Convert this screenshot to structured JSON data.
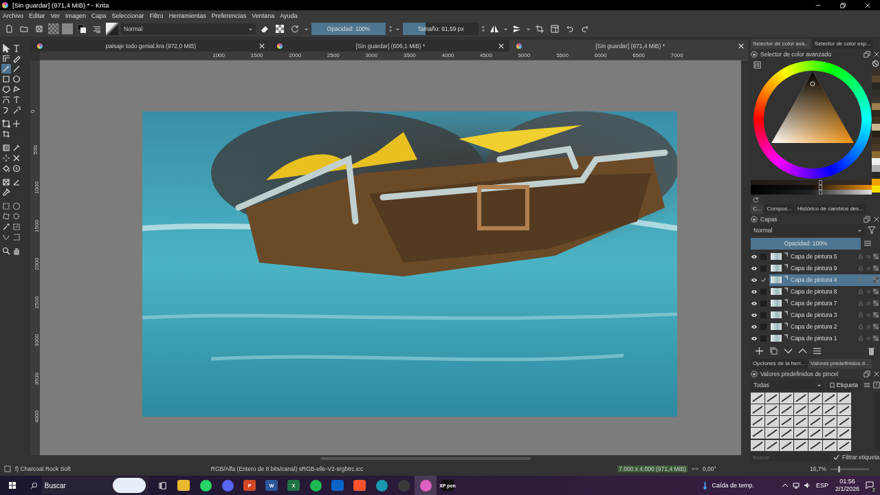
{
  "window": {
    "title": "[Sin guardar]  (971,4 MiB) * - Krita"
  },
  "menu": [
    "Archivo",
    "Editar",
    "Ver",
    "Imagen",
    "Capa",
    "Seleccionar",
    "Filtro",
    "Herramientas",
    "Preferencias",
    "Ventana",
    "Ayuda"
  ],
  "toolbar": {
    "blend_mode": "Normal",
    "opacity": {
      "label": "Opacidad: 100%",
      "level": 1
    },
    "size": {
      "label": "Tamaño: 61,59 px",
      "level": 0.3
    }
  },
  "tool_groups": [
    [
      {
        "selected": false
      },
      {
        "selected": false
      },
      {
        "selected": false
      },
      {
        "selected": false
      },
      {
        "selected": true
      },
      {
        "selected": false
      },
      {
        "selected": false
      },
      {
        "selected": false
      },
      {
        "selected": false
      },
      {
        "selected": false
      },
      {
        "selected": false
      },
      {
        "selected": false
      },
      {
        "selected": false
      },
      {
        "selected": false
      }
    ],
    [
      {
        "selected": false
      },
      {
        "selected": false
      },
      {
        "selected": false
      }
    ],
    [
      {
        "selected": false
      },
      {
        "selected": false
      },
      {
        "selected": false
      },
      {
        "selected": false
      },
      {
        "selected": false
      },
      {
        "selected": false
      }
    ],
    [
      {
        "selected": false
      },
      {
        "selected": false
      },
      {
        "selected": false
      }
    ],
    [
      {
        "selected": false
      },
      {
        "selected": false
      },
      {
        "selected": false
      },
      {
        "selected": false
      },
      {
        "selected": false
      },
      {
        "selected": false
      },
      {
        "selected": false
      },
      {
        "selected": false
      }
    ],
    [
      {
        "selected": false
      },
      {
        "selected": false
      }
    ]
  ],
  "documents": [
    {
      "title": "paisaje todo genial.kra (972,0 MiB)",
      "selected": false
    },
    {
      "title": "[Sin guardar]  (606,1 MiB) *",
      "selected": false
    },
    {
      "title": "[Sin guardar]  (971,4 MiB) *",
      "selected": true
    }
  ],
  "rulers": {
    "horizontal": [
      "1000",
      "1500",
      "2000",
      "2500",
      "3000",
      "3500",
      "4000",
      "4500",
      "5000",
      "5500",
      "6000",
      "6500",
      "7000"
    ],
    "vertical": [
      "0",
      "500",
      "1000",
      "1500",
      "2000",
      "2500",
      "3000",
      "3500",
      "4000"
    ]
  },
  "color_dock": {
    "tabs": [
      {
        "label": "Selector de color ava...",
        "selected": true
      },
      {
        "label": "Selector de color esp...",
        "selected": false
      }
    ],
    "title": "Selector de color avanzado",
    "sliders": [
      {
        "level": 0.56
      },
      {
        "level": 0.56
      },
      {
        "level": 0.56
      }
    ],
    "swatches": [
      {
        "color": "#3a3228"
      },
      {
        "color": "#5a4530"
      },
      {
        "color": "#2a2620"
      },
      {
        "color": "#302c26"
      },
      {
        "color": "#3c3630"
      },
      {
        "color": "#a08050"
      },
      {
        "color": "#2e2818"
      },
      {
        "color": "#403020"
      },
      {
        "color": "#c8b890"
      },
      {
        "color": "#2a2218"
      },
      {
        "color": "#3e3020"
      },
      {
        "color": "#4a3828"
      },
      {
        "color": "#8a6a30"
      },
      {
        "color": "#f0f0f0"
      },
      {
        "color": "#b0b0b0"
      },
      {
        "color": "#2a2a2a"
      },
      {
        "color": "#f0a000"
      },
      {
        "color": "#f8e000"
      }
    ]
  },
  "layers_dock": {
    "tabs": [
      {
        "label": "C...",
        "selected": true
      },
      {
        "label": "Compos...",
        "selected": false
      },
      {
        "label": "Histórico de cambios des...",
        "selected": false
      }
    ],
    "title": "Capas",
    "blend_mode": "Normal",
    "opacity": {
      "label": "Opacidad:  100%",
      "level": 1
    },
    "layers": [
      {
        "name": "Capa de pintura 5",
        "visible": true,
        "checked": false,
        "selected": false
      },
      {
        "name": "Capa de pintura 9",
        "visible": true,
        "checked": false,
        "selected": false
      },
      {
        "name": "Capa de pintura 4",
        "visible": true,
        "checked": true,
        "selected": true
      },
      {
        "name": "Capa de pintura 8",
        "visible": true,
        "checked": false,
        "selected": false
      },
      {
        "name": "Capa de pintura 7",
        "visible": true,
        "checked": false,
        "selected": false
      },
      {
        "name": "Capa de pintura 3",
        "visible": true,
        "checked": false,
        "selected": false
      },
      {
        "name": "Capa de pintura 2",
        "visible": true,
        "checked": false,
        "selected": false
      },
      {
        "name": "Capa de pintura 1",
        "visible": true,
        "checked": false,
        "selected": false
      }
    ]
  },
  "brush_dock": {
    "tabs": [
      {
        "label": "Opciones de la herr...",
        "selected": false
      },
      {
        "label": "Valores predefinidos d...",
        "selected": true
      }
    ],
    "title": "Valores predefinidos de pincel",
    "tag": "Todas",
    "tag_button": "Etiqueta",
    "search": {
      "placeholder": "Buscar"
    },
    "filter": {
      "label": "Filtrar etiqueta",
      "checked": true
    }
  },
  "status_bar": {
    "brush": "f) Charcoal Rock Soft",
    "color_space": "RGB/Alfa (Entero de 8 bits/canal)  sRGB-elle-V2-srgbtrc.icc",
    "dimensions": "7.000 x 4.000 (971,4 MiB)",
    "rotation": "0,00°",
    "zoom": "16,7%",
    "zoom_slider": {
      "level": 0.2
    }
  },
  "taskbar": {
    "search": {
      "placeholder": "Buscar"
    },
    "apps": [
      {
        "kind": "tile",
        "color": "#e8b830",
        "selected": false
      },
      {
        "kind": "circle",
        "color": "#25d366",
        "selected": false
      },
      {
        "kind": "circle",
        "color": "#5865f2",
        "selected": false
      },
      {
        "kind": "tile",
        "color": "#d24726",
        "label": "P",
        "selected": false
      },
      {
        "kind": "tile",
        "color": "#2b579a",
        "label": "W",
        "selected": false
      },
      {
        "kind": "tile",
        "color": "#217346",
        "label": "X",
        "selected": false
      },
      {
        "kind": "circle",
        "color": "#1db954",
        "selected": false
      },
      {
        "kind": "tile",
        "color": "#0a64c8",
        "selected": false
      },
      {
        "kind": "tile",
        "color": "#fb542b",
        "selected": false
      },
      {
        "kind": "circle",
        "color": "#1a9ab0",
        "selected": false
      },
      {
        "kind": "circle",
        "color": "#3a3a3a",
        "selected": false
      },
      {
        "kind": "circle",
        "color": "#e060c0",
        "selected": true
      },
      {
        "kind": "tile",
        "color": "#111111",
        "label": "XP pen",
        "selected": false
      }
    ],
    "weather": "Caída de temp.",
    "language": "ESP",
    "time": "01:56",
    "date": "2/1/2026",
    "notifications": "2"
  }
}
